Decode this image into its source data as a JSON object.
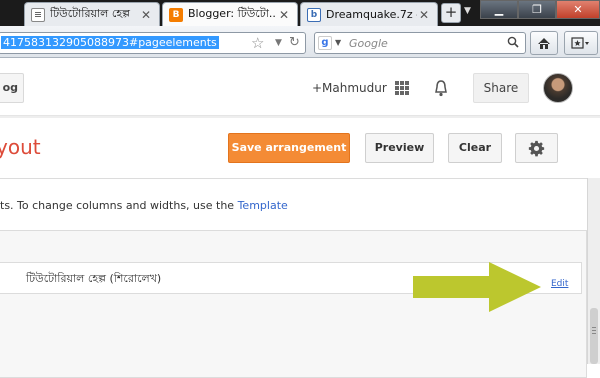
{
  "browser": {
    "tabs": [
      {
        "label": "টিউটোরিয়াল হেল্প"
      },
      {
        "label": "Blogger: টিউটো..."
      },
      {
        "label": "Dreamquake.7z - ..."
      }
    ],
    "new_tab_label": "+",
    "url": "417583132905088973#pageelements",
    "search_placeholder": "Google"
  },
  "header": {
    "logo_text": "og",
    "user_link": "+Mahmudur",
    "share_label": "Share"
  },
  "toolbar": {
    "title": "yout",
    "save_label": "Save arrangement",
    "preview_label": "Preview",
    "clear_label": "Clear"
  },
  "content": {
    "info_text": "ts. To change columns and widths, use the",
    "template_link": "Template",
    "gadget_title": "টিউটোরিয়াল হেল্প (শিরোলেখ)",
    "edit_link": "Edit"
  },
  "colors": {
    "accent_orange": "#f48b35",
    "title_red": "#dd4b39",
    "link_blue": "#3366cc",
    "arrow_green": "#bcc72e"
  }
}
